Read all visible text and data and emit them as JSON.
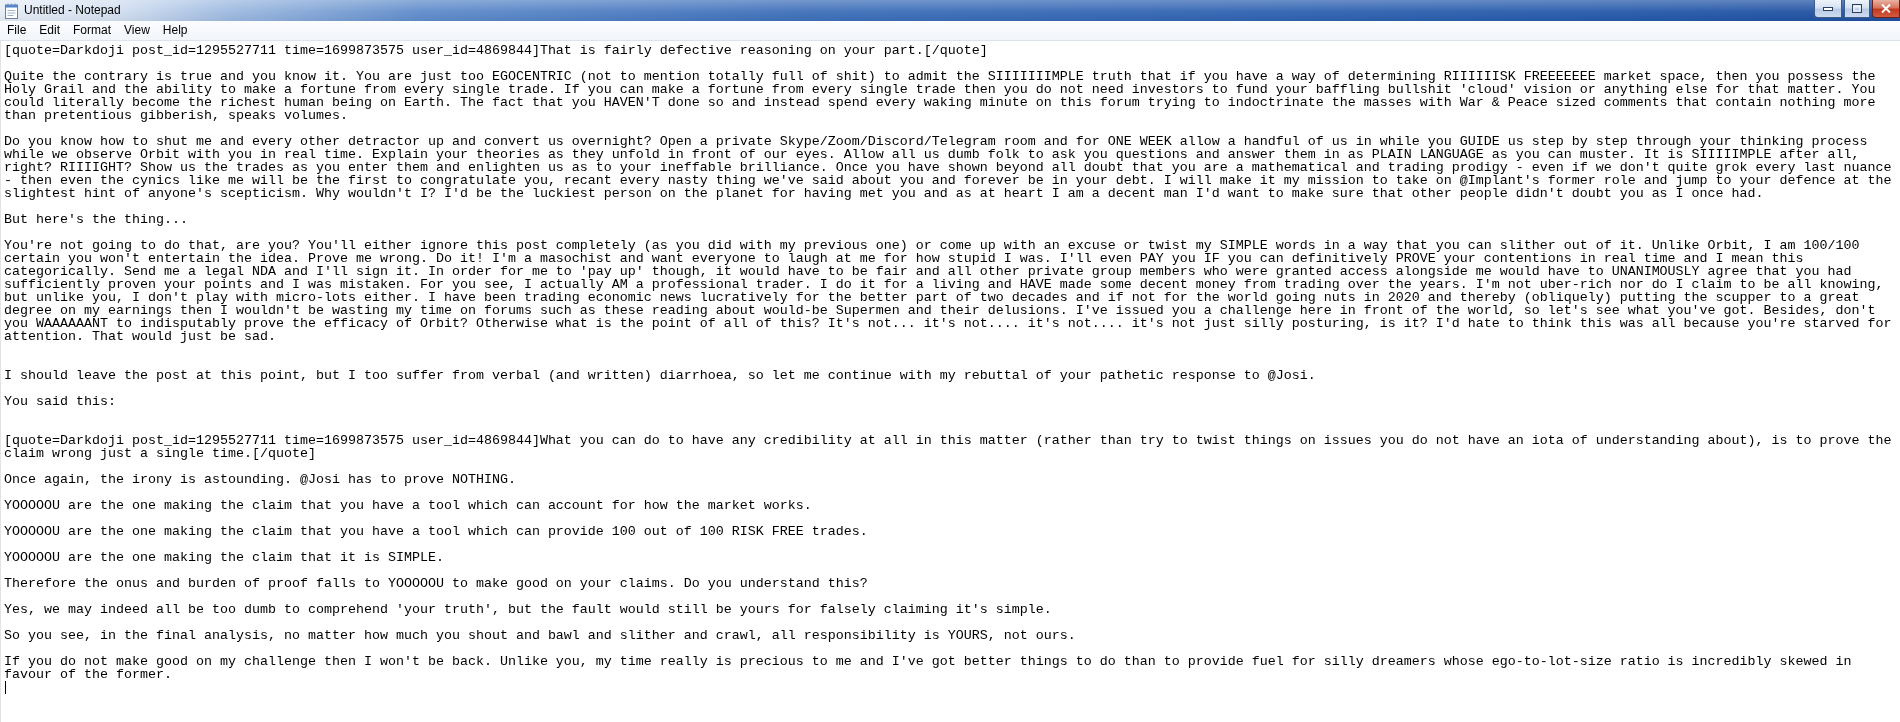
{
  "window": {
    "title": "Untitled - Notepad"
  },
  "menu_bar": {
    "items": [
      "File",
      "Edit",
      "Format",
      "View",
      "Help"
    ]
  },
  "document": {
    "blocks": [
      {
        "kind": "paragraph",
        "lines": [
          "[quote=Darkdoji post_id=1295527711 time=1699873575 user_id=4869844]That is fairly defective reasoning on your part.[/quote]"
        ]
      },
      {
        "kind": "blank_line"
      },
      {
        "kind": "paragraph",
        "lines": [
          "Quite the contrary is true and you know it. You are just too EGOCENTRIC (not to mention totally full of shit) to admit the SIIIIIIIMPLE truth that if you have a way of determining RIIIIIISK FREEEEEEE market space, then you possess the",
          "Holy Grail and the ability to make a fortune from every single trade. If you can make a fortune from every single trade then you do not need investors to fund your baffling bullshit 'cloud' vision or anything else for that matter. You",
          "could literally become the richest human being on Earth. The fact that you HAVEN'T done so and instead spend every waking minute on this forum trying to indoctrinate the masses with War & Peace sized comments that contain nothing more",
          "than pretentious gibberish, speaks volumes."
        ]
      },
      {
        "kind": "blank_line"
      },
      {
        "kind": "paragraph",
        "lines": [
          "Do you know how to shut me and every other detractor up and convert us overnight? Open a private Skype/Zoom/Discord/Telegram room and for ONE WEEK allow a handful of us in while you GUIDE us step by step through your thinking process",
          "while we observe Orbit with you in real time. Explain your theories as they unfold in front of our eyes. Allow all us dumb folk to ask you questions and answer them in as PLAIN LANGUAGE as you can muster. It is SIIIIIMPLE after all,",
          "right? RIIIIGHT? Show us the trades as you enter them and enlighten us as to your ineffable brilliance. Once you have shown beyond all doubt that you are a mathematical and trading prodigy - even if we don't quite grok every last nuance",
          "- then even the cynics like me will be the first to congratulate you, recant every nasty thing we've said about you and forever be in your debt. I will make it my mission to take on @Implant's former role and jump to your defence at the",
          "slightest hint of anyone's scepticism. Why wouldn't I? I'd be the luckiest person on the planet for having met you and as at heart I am a decent man I'd want to make sure that other people didn't doubt you as I once had."
        ]
      },
      {
        "kind": "blank_line"
      },
      {
        "kind": "paragraph",
        "lines": [
          "But here's the thing..."
        ]
      },
      {
        "kind": "blank_line"
      },
      {
        "kind": "paragraph",
        "lines": [
          "You're not going to do that, are you? You'll either ignore this post completely (as you did with my previous one) or come up with an excuse or twist my SIMPLE words in a way that you can slither out of it. Unlike Orbit, I am 100/100",
          "certain you won't entertain the idea. Prove me wrong. Do it! I'm a masochist and want everyone to laugh at me for how stupid I was. I'll even PAY you IF you can definitively PROVE your contentions in real time and I mean this",
          "categorically. Send me a legal NDA and I'll sign it. In order for me to 'pay up' though, it would have to be fair and all other private group members who were granted access alongside me would have to UNANIMOUSLY agree that you had",
          "sufficiently proven your points and I was mistaken. For you see, I actually AM a professional trader. I do it for a living and HAVE made some decent money from trading over the years. I'm not uber-rich nor do I claim to be all knowing,",
          "but unlike you, I don't play with micro-lots either. I have been trading economic news lucratively for the better part of two decades and if not for the world going nuts in 2020 and thereby (obliquely) putting the scupper to a great",
          "degree on my earnings then I wouldn't be wasting my time on forums such as these reading about would-be Supermen and their delusions. I've issued you a challenge here in front of the world, so let's see what you've got. Besides, don't",
          "you WAAAAAANT to indisputably prove the efficacy of Orbit? Otherwise what is the point of all of this? It's not... it's not.... it's not.... it's not just silly posturing, is it? I'd hate to think this was all because you're starved for",
          "attention. That would just be sad."
        ]
      },
      {
        "kind": "blank_line"
      },
      {
        "kind": "blank_line"
      },
      {
        "kind": "paragraph",
        "lines": [
          "I should leave the post at this point, but I too suffer from verbal (and written) diarrhoea, so let me continue with my rebuttal of your pathetic response to @Josi."
        ]
      },
      {
        "kind": "blank_line"
      },
      {
        "kind": "paragraph",
        "lines": [
          "You said this:"
        ]
      },
      {
        "kind": "blank_line"
      },
      {
        "kind": "blank_line"
      },
      {
        "kind": "paragraph",
        "lines": [
          "[quote=Darkdoji post_id=1295527711 time=1699873575 user_id=4869844]What you can do to have any credibility at all in this matter (rather than try to twist things on issues you do not have an iota of understanding about), is to prove the",
          "claim wrong just a single time.[/quote]"
        ]
      },
      {
        "kind": "blank_line"
      },
      {
        "kind": "paragraph",
        "lines": [
          "Once again, the irony is astounding. @Josi has to prove NOTHING."
        ]
      },
      {
        "kind": "blank_line"
      },
      {
        "kind": "paragraph",
        "lines": [
          "YOOOOOU are the one making the claim that you have a tool which can account for how the market works."
        ]
      },
      {
        "kind": "blank_line"
      },
      {
        "kind": "paragraph",
        "lines": [
          "YOOOOOU are the one making the claim that you have a tool which can provide 100 out of 100 RISK FREE trades."
        ]
      },
      {
        "kind": "blank_line"
      },
      {
        "kind": "paragraph",
        "lines": [
          "YOOOOOU are the one making the claim that it is SIMPLE."
        ]
      },
      {
        "kind": "blank_line"
      },
      {
        "kind": "paragraph",
        "lines": [
          "Therefore the onus and burden of proof falls to YOOOOOU to make good on your claims. Do you understand this?"
        ]
      },
      {
        "kind": "blank_line"
      },
      {
        "kind": "paragraph",
        "lines": [
          "Yes, we may indeed all be too dumb to comprehend 'your truth', but the fault would still be yours for falsely claiming it's simple."
        ]
      },
      {
        "kind": "blank_line"
      },
      {
        "kind": "paragraph",
        "lines": [
          "So you see, in the final analysis, no matter how much you shout and bawl and slither and crawl, all responsibility is YOURS, not ours."
        ]
      },
      {
        "kind": "blank_line"
      },
      {
        "kind": "paragraph",
        "lines": [
          "If you do not make good on my challenge then I won't be back. Unlike you, my time really is precious to me and I've got better things to do than to provide fuel for silly dreamers whose ego-to-lot-size ratio is incredibly skewed in",
          "favour of the former."
        ]
      },
      {
        "kind": "cursor_line"
      }
    ]
  }
}
